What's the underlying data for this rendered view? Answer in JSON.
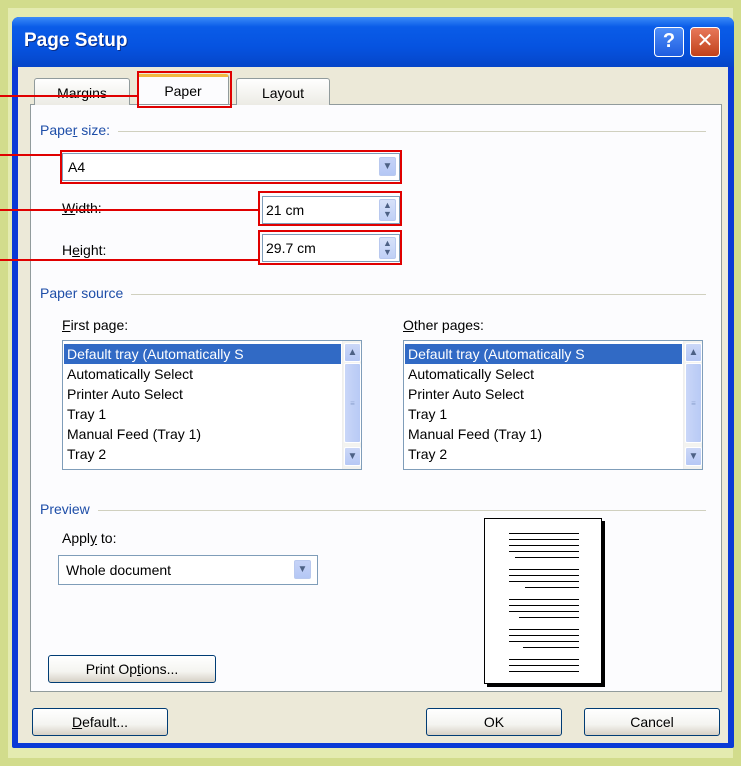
{
  "window": {
    "title": "Page Setup",
    "help_glyph": "?",
    "close_glyph": "✕"
  },
  "tabs": [
    {
      "label": "Margins"
    },
    {
      "label": "Paper"
    },
    {
      "label": "Layout"
    }
  ],
  "paper_size": {
    "group_label_a": "Pape",
    "group_label_u": "r",
    "group_label_b": " size:",
    "selected": "A4",
    "width_label_a": "",
    "width_label_u": "W",
    "width_label_b": "idth:",
    "width_value": "21 cm",
    "height_label_a": "H",
    "height_label_u": "e",
    "height_label_b": "ight:",
    "height_value": "29.7 cm"
  },
  "paper_source": {
    "group_label": "Paper source",
    "first_label_u": "F",
    "first_label_b": "irst page:",
    "other_label_u": "O",
    "other_label_b": "ther pages:",
    "first_items": [
      "Default tray (Automatically S",
      "Automatically Select",
      "Printer Auto Select",
      "Tray 1",
      "Manual Feed (Tray 1)",
      "Tray 2"
    ],
    "other_items": [
      "Default tray (Automatically S",
      "Automatically Select",
      "Printer Auto Select",
      "Tray 1",
      "Manual Feed (Tray 1)",
      "Tray 2"
    ]
  },
  "preview": {
    "group_label": "Preview",
    "apply_label_a": "Appl",
    "apply_label_u": "y",
    "apply_label_b": " to:",
    "apply_value": "Whole document"
  },
  "buttons": {
    "print_options_a": "Print Op",
    "print_options_u": "t",
    "print_options_b": "ions...",
    "default_u": "D",
    "default_b": "efault...",
    "ok": "OK",
    "cancel": "Cancel"
  },
  "icons": {
    "dropdown": "chevron-down-icon",
    "spin": "spin-updown-icon",
    "scroll_up": "chevron-up-icon",
    "scroll_down": "chevron-down-icon"
  },
  "colors": {
    "title_bar": "#0653e0",
    "highlight_box": "#e00000",
    "selection": "#316ac5",
    "group_label": "#1e4ea8"
  }
}
